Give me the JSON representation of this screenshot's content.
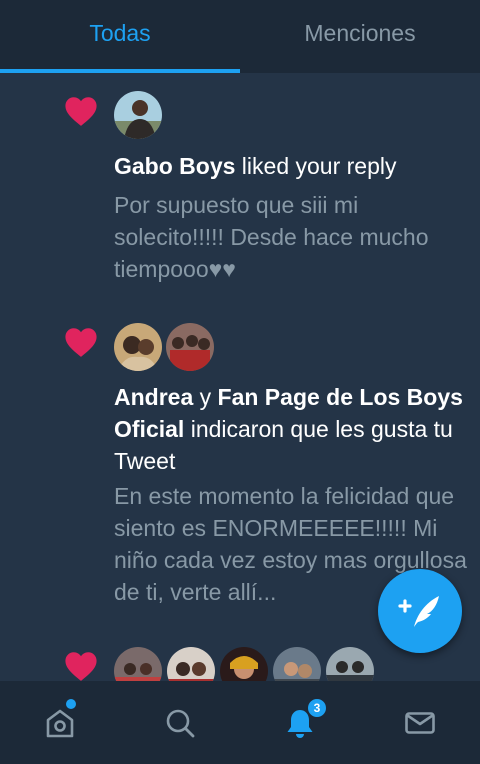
{
  "tabs": {
    "all": "Todas",
    "mentions": "Menciones"
  },
  "notifications": [
    {
      "actor1": "Gabo Boys",
      "connector": "",
      "actor2": "",
      "action": " liked your reply",
      "body": "Por supuesto que siii mi solecito!!!!! Desde hace mucho tiempooo♥♥"
    },
    {
      "actor1": "Andrea",
      "connector": " y ",
      "actor2": "Fan Page de Los Boys Oficial",
      "action": " indicaron que les gusta tu Tweet",
      "body": "En este momento la felicidad que siento es ENORMEEEEE!!!!! Mi niño cada vez estoy mas orgullosa de ti, verte allí..."
    }
  ],
  "bottom_nav": {
    "home_icon": "home-icon",
    "search_icon": "search-icon",
    "notifications_icon": "bell-icon",
    "notifications_badge": "3",
    "messages_icon": "mail-icon"
  },
  "colors": {
    "background": "#243447",
    "bars": "#1c2938",
    "accent": "#1da1f2",
    "heart": "#e0245e",
    "secondary_text": "#8899a6"
  }
}
